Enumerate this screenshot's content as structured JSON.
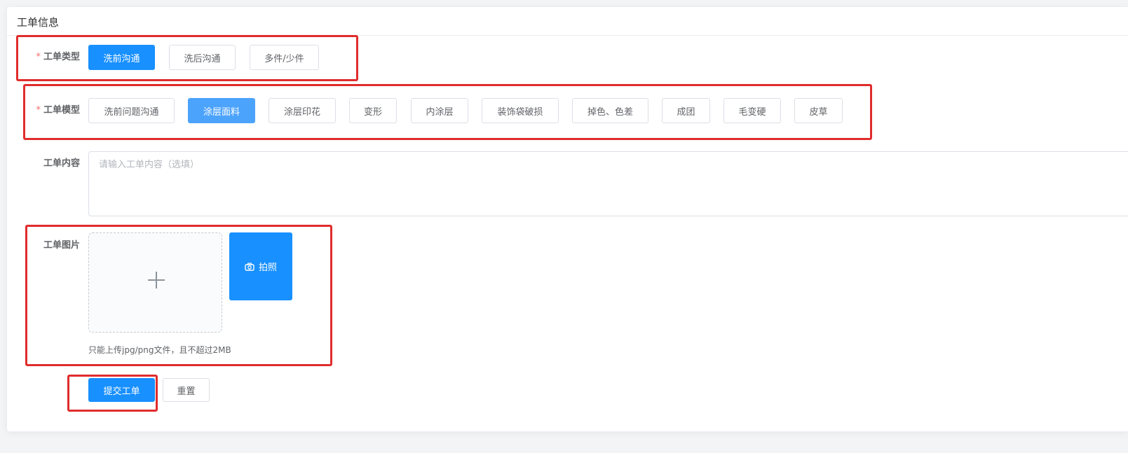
{
  "card": {
    "title": "工单信息"
  },
  "form": {
    "type": {
      "label": "工单类型",
      "required_mark": "*",
      "options": [
        "洗前沟通",
        "洗后沟通",
        "多件/少件"
      ],
      "selected": "洗前沟通"
    },
    "model": {
      "label": "工单模型",
      "required_mark": "*",
      "options": [
        "洗前问题沟通",
        "涂层面料",
        "涂层印花",
        "变形",
        "内涂层",
        "装饰袋破损",
        "掉色、色差",
        "成团",
        "毛变硬",
        "皮草"
      ],
      "selected": "涂层面料"
    },
    "content": {
      "label": "工单内容",
      "value": "",
      "placeholder": "请输入工单内容（选填）"
    },
    "images": {
      "label": "工单图片",
      "upload_icon": "plus-icon",
      "photo_button_label": "拍照",
      "photo_icon": "camera-icon",
      "hint": "只能上传jpg/png文件，且不超过2MB"
    },
    "actions": {
      "submit_label": "提交工单",
      "reset_label": "重置"
    }
  },
  "colors": {
    "primary": "#1890ff",
    "primary_light": "#4ca3fc",
    "required": "#f56c6c",
    "highlight_box": "#e02c2c"
  }
}
